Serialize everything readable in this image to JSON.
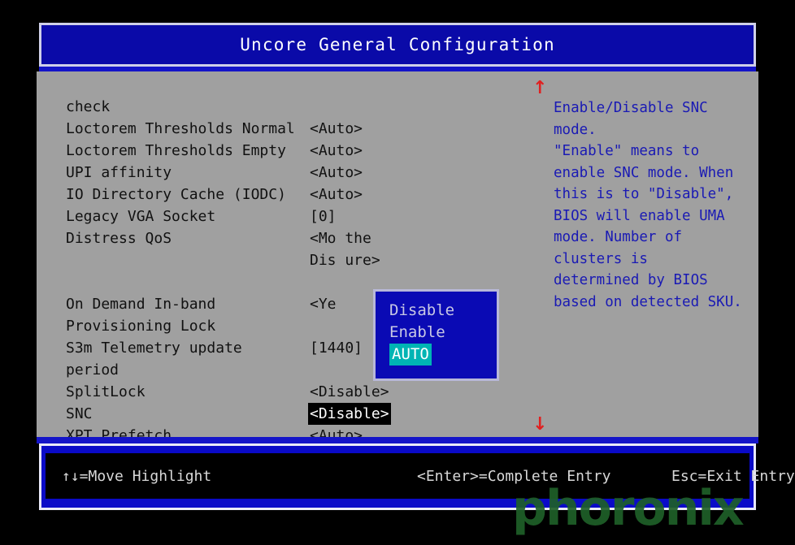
{
  "header": {
    "title": "Uncore General Configuration"
  },
  "colors": {
    "window_bg": "#000000",
    "panel_bg": "#a0a0a0",
    "title_bg": "#0a0aa8",
    "help_text": "#1a1ab4",
    "popup_bg": "#0a0ab4",
    "popup_highlight": "#00b4b4",
    "selection_bg": "#000000",
    "scroll_arrow": "#e02020",
    "footer_bg": "#0a0ac8",
    "watermark": "#1e6028"
  },
  "settings": [
    {
      "label": "check",
      "value": "",
      "selected": false
    },
    {
      "label": "Loctorem Thresholds Normal",
      "value": "<Auto>",
      "selected": false
    },
    {
      "label": "Loctorem Thresholds Empty",
      "value": "<Auto>",
      "selected": false
    },
    {
      "label": "UPI affinity",
      "value": "<Auto>",
      "selected": false
    },
    {
      "label": "IO Directory Cache (IODC)",
      "value": "<Auto>",
      "selected": false
    },
    {
      "label": "Legacy VGA Socket",
      "value": "[0]",
      "selected": false
    },
    {
      "label": "Distress QoS",
      "value": "<Mo                the",
      "selected": false
    },
    {
      "label": "",
      "value": "Dis                ure>",
      "selected": false
    },
    {
      "label": "On Demand In-band",
      "value": "<Ye",
      "selected": false
    },
    {
      "label": "Provisioning Lock",
      "value": "",
      "selected": false
    },
    {
      "label": "S3m Telemetry update",
      "value": "[1440]",
      "selected": false
    },
    {
      "label": "period",
      "value": "",
      "selected": false
    },
    {
      "label": "SplitLock",
      "value": "<Disable>",
      "selected": false
    },
    {
      "label": "SNC",
      "value": "<Disable>",
      "selected": true
    },
    {
      "label": "XPT Prefetch",
      "value": "<Auto>",
      "selected": false
    }
  ],
  "scroll": {
    "up_icon": "↑",
    "down_icon": "↓"
  },
  "help": {
    "lines": [
      "Enable/Disable SNC",
      "mode.",
      "\"Enable\" means to",
      "enable SNC mode. When",
      "this is to \"Disable\",",
      "BIOS will enable UMA",
      "mode. Number of",
      "clusters is",
      "determined by BIOS",
      "based on detected SKU."
    ]
  },
  "dropdown": {
    "options": [
      {
        "label": "Disable",
        "active": false
      },
      {
        "label": "Enable",
        "active": false
      },
      {
        "label": "AUTO",
        "active": true
      }
    ]
  },
  "footer": {
    "keys": [
      "↑↓=Move Highlight",
      "<Enter>=Complete Entry",
      "Esc=Exit Entry"
    ]
  },
  "watermark": {
    "text": "phoronix"
  }
}
